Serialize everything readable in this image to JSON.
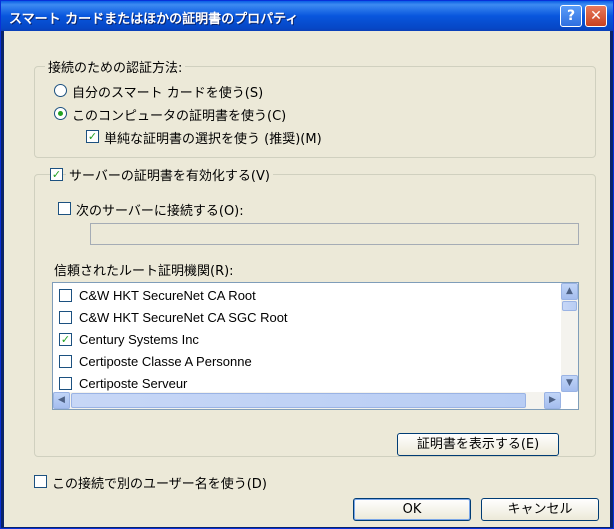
{
  "window": {
    "title": "スマート カードまたはほかの証明書のプロパティ",
    "help_label": "?",
    "close_label": "✕"
  },
  "auth_group": {
    "legend": "接続のための認証方法:",
    "radio_smartcard": "自分のスマート カードを使う(S)",
    "radio_cert": "このコンピュータの証明書を使う(C)",
    "simple_select": "単純な証明書の選択を使う (推奨)(M)"
  },
  "validate_group": {
    "legend": "サーバーの証明書を有効化する(V)",
    "connect_servers": "次のサーバーに接続する(O):",
    "servers_value": "",
    "trusted_root_label": "信頼されたルート証明機関(R):",
    "roots": [
      {
        "label": "C&W HKT SecureNet CA Root",
        "checked": false
      },
      {
        "label": "C&W HKT SecureNet CA SGC Root",
        "checked": false
      },
      {
        "label": "Century Systems Inc",
        "checked": true
      },
      {
        "label": "Certiposte Classe A Personne",
        "checked": false
      },
      {
        "label": "Certiposte Serveur",
        "checked": false
      }
    ],
    "view_cert_button": "証明書を表示する(E)"
  },
  "use_different_user": "この接続で別のユーザー名を使う(D)",
  "buttons": {
    "ok": "OK",
    "cancel": "キャンセル"
  },
  "colors": {
    "title_bar": "#0856dd",
    "dialog_bg": "#ece9d8",
    "check_mark": "#21a121"
  }
}
